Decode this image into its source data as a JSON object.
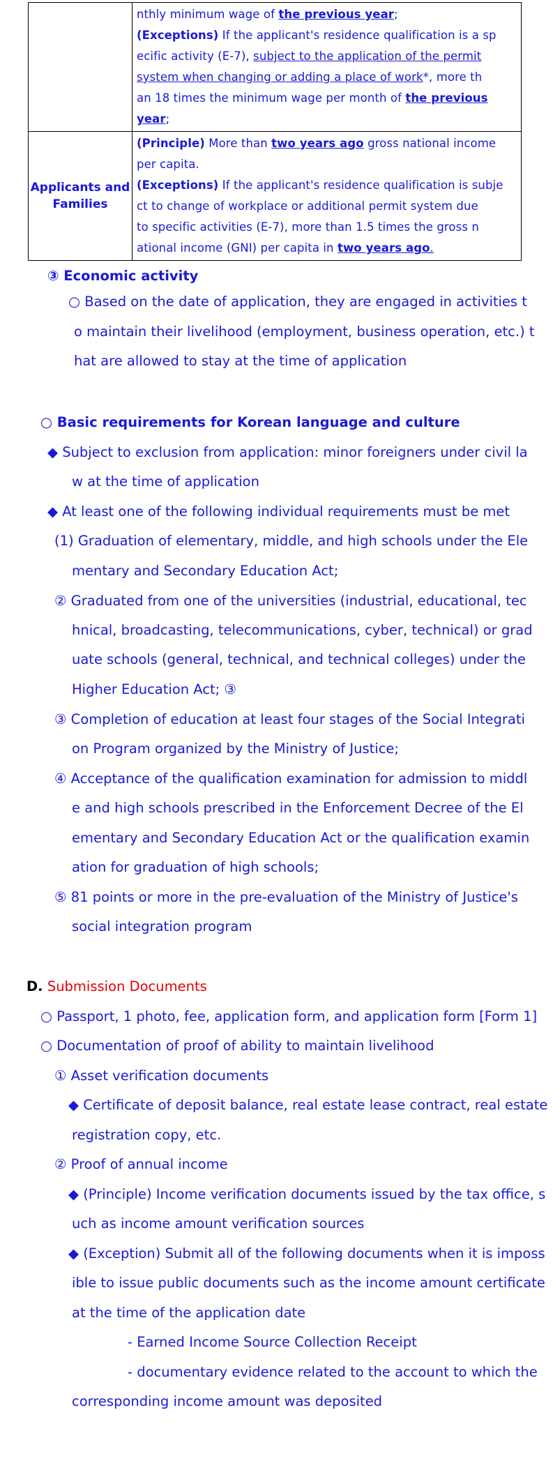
{
  "table": {
    "row1": {
      "left": "",
      "lines": [
        {
          "parts": [
            {
              "t": "nthly minimum wage of ",
              "s": ""
            },
            {
              "t": "the previous year",
              "s": "bu"
            },
            {
              "t": ";",
              "s": ""
            }
          ]
        },
        {
          "parts": [
            {
              "t": "(Exceptions)",
              "s": "b"
            },
            {
              "t": " If the applicant's residence qualification is a sp",
              "s": ""
            }
          ]
        },
        {
          "parts": [
            {
              "t": "ecific activity (E-7), ",
              "s": ""
            },
            {
              "t": "subject to the application of the permit",
              "s": "u"
            }
          ]
        },
        {
          "parts": [
            {
              "t": "system when changing or adding a place of work",
              "s": "u"
            },
            {
              "t": "*, more th",
              "s": ""
            }
          ]
        },
        {
          "parts": [
            {
              "t": "an 18 times the minimum wage per month of ",
              "s": ""
            },
            {
              "t": "the previous",
              "s": "bu"
            }
          ]
        },
        {
          "parts": [
            {
              "t": "year",
              "s": "bu"
            },
            {
              "t": ";",
              "s": ""
            }
          ]
        }
      ]
    },
    "row2": {
      "left": "Applicants and Families",
      "lines": [
        {
          "parts": [
            {
              "t": "(Principle)",
              "s": "b"
            },
            {
              "t": " More than ",
              "s": ""
            },
            {
              "t": "two years ago",
              "s": "bu"
            },
            {
              "t": " gross national income",
              "s": ""
            }
          ]
        },
        {
          "parts": [
            {
              "t": "per capita.",
              "s": ""
            }
          ]
        },
        {
          "parts": [
            {
              "t": "(Exceptions)",
              "s": "b"
            },
            {
              "t": " If the applicant's residence qualification is subje",
              "s": ""
            }
          ]
        },
        {
          "parts": [
            {
              "t": "ct to change of workplace or additional permit system due",
              "s": ""
            }
          ]
        },
        {
          "parts": [
            {
              "t": "to specific activities (E-7), more than 1.5 times the gross n",
              "s": ""
            }
          ]
        },
        {
          "parts": [
            {
              "t": "ational income (GNI) per capita in ",
              "s": ""
            },
            {
              "t": "two years ago",
              "s": "bu"
            },
            {
              "t": ".",
              "s": "u"
            }
          ]
        }
      ]
    }
  },
  "economic": {
    "heading": "③ Economic activity",
    "lines": [
      "○ Based on the date of application, they are engaged in activities t",
      "o maintain their livelihood (employment, business operation, etc.) t",
      "hat are allowed to stay at the time of application"
    ]
  },
  "korean": {
    "heading": "○ Basic requirements for Korean language and culture",
    "exclusion": [
      "◆ Subject to exclusion from application: minor foreigners under civil la",
      "w at the time of application"
    ],
    "atleast": "◆ At least one of the following individual requirements must be met",
    "items": [
      [
        "(1) Graduation of elementary, middle, and high schools under the Ele",
        "mentary and Secondary Education Act;"
      ],
      [
        "② Graduated from one of the universities (industrial, educational, tec",
        "hnical, broadcasting, telecommunications, cyber, technical) or grad",
        "uate schools (general, technical, and technical colleges) under the",
        "Higher Education Act; ③"
      ],
      [
        "③ Completion of education at least four stages of the Social Integrati",
        "on Program organized by the Ministry of Justice;"
      ],
      [
        "④ Acceptance of the qualification examination for admission to middl",
        "e and high schools prescribed in the Enforcement Decree of the El",
        "ementary and Secondary Education Act or the qualification examin",
        "ation for graduation of high schools;"
      ],
      [
        "⑤ 81 points or more in the pre-evaluation of the Ministry of Justice's",
        "social integration program"
      ]
    ]
  },
  "submission": {
    "prefix": "D.",
    "heading": "Submission Documents",
    "passport": "○ Passport, 1 photo, fee, application form, and application form [Form 1]",
    "proof": "○ Documentation of proof of ability to maintain livelihood",
    "asset_heading": "① Asset verification documents",
    "asset_lines": [
      "◆ Certificate of deposit balance, real estate lease contract, real estate",
      "registration copy, etc."
    ],
    "income_heading": "② Proof of annual income",
    "principle_lines": [
      "◆ (Principle) Income verification documents issued by the tax office, s",
      "uch as income amount verification sources"
    ],
    "exception_lines": [
      "◆ (Exception) Submit all of the following documents when it is imposs",
      "ible to issue public documents such as the income amount certificate",
      "at the time of the application date"
    ],
    "receipt": "- Earned Income Source Collection Receipt",
    "evidence_lines": [
      "- documentary evidence related to the account to which the",
      "corresponding income amount was deposited"
    ]
  }
}
